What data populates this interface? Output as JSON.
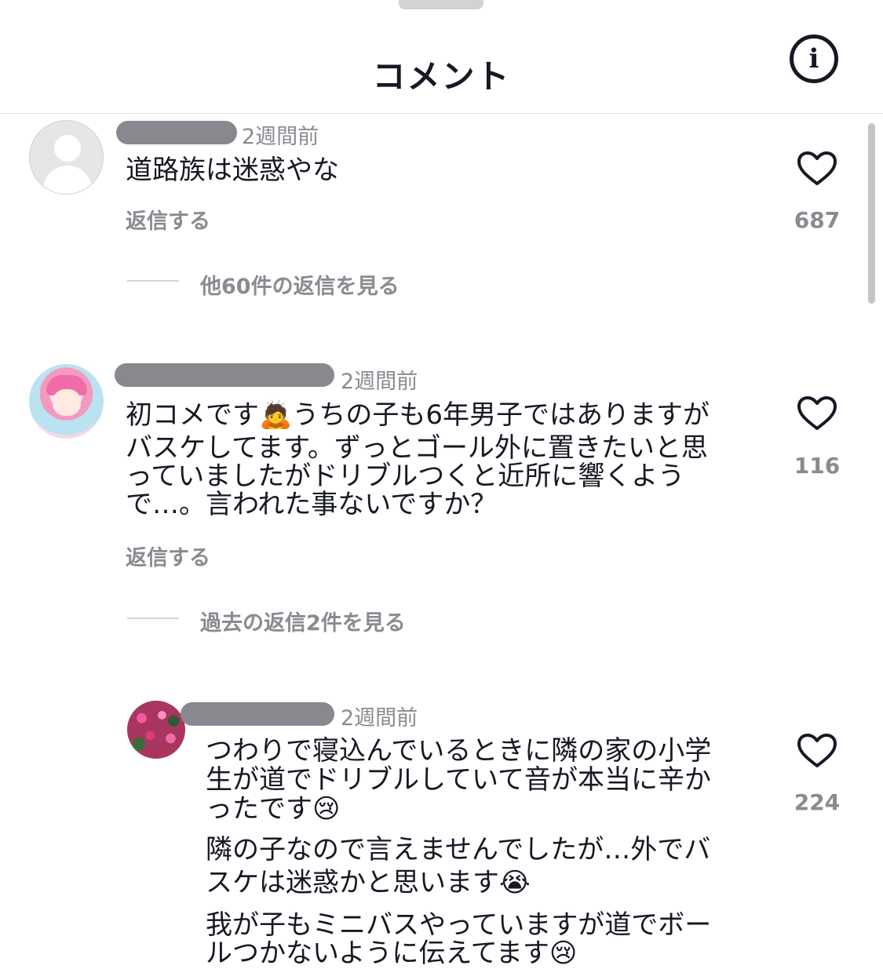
{
  "header": {
    "title": "コメント",
    "info_icon": "info-icon"
  },
  "comments": [
    {
      "time": "2週間前",
      "text": "道路族は迷惑やな",
      "reply_label": "返信する",
      "likes": "687",
      "more_replies": "他60件の返信を見る"
    },
    {
      "time": "2週間前",
      "text_lines": [
        "初コメです🙇うちの子も6年男子ではありますが",
        "バスケしてます。ずっとゴール外に置きたいと思",
        "っていましたがドリブルつくと近所に響くよう",
        "で…。言われた事ないですか？"
      ],
      "reply_label": "返信する",
      "likes": "116",
      "more_replies": "過去の返信2件を見る"
    },
    {
      "time": "2週間前",
      "text_lines": [
        "つわりで寝込んでいるときに隣の家の小学",
        "生が道でドリブルしていて音が本当に辛か",
        "ったです😢",
        "隣の子なので言えませんでしたが…外でバ",
        "スケは迷惑かと思います😭",
        "我が子もミニバスやっていますが道でボー",
        "ルつかないように伝えてます😢"
      ],
      "likes": "224"
    }
  ]
}
